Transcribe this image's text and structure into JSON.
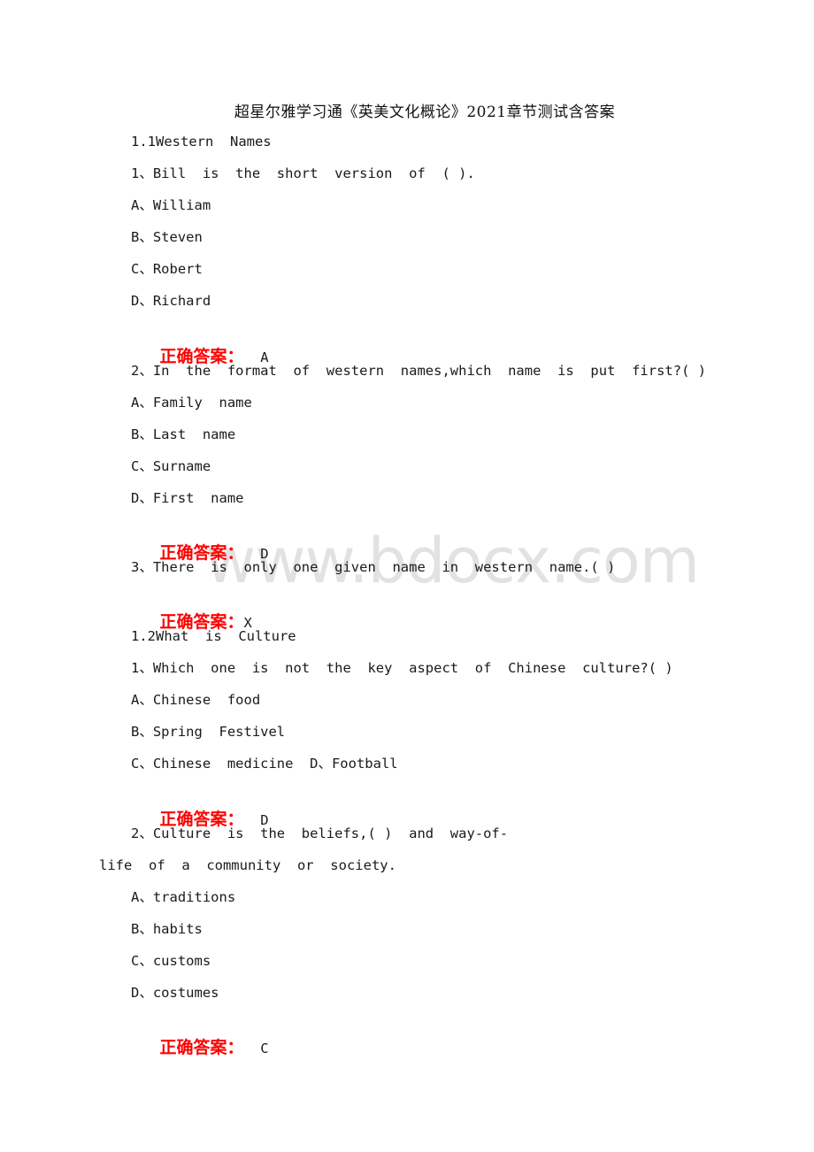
{
  "document": {
    "title": "超星尔雅学习通《英美文化概论》2021章节测试含答案",
    "watermark": "www.bdocx.com",
    "answer_label": "正确答案：",
    "colors": {
      "answer_label": "#ff0000",
      "text": "#1a1a1a"
    },
    "sections": [
      {
        "heading": "1.1Western  Names",
        "questions": [
          {
            "text": "1、Bill  is  the  short  version  of  ( ).",
            "options": [
              "A、William",
              "B、Steven",
              "C、Robert",
              "D、Richard"
            ],
            "answer": "  A"
          },
          {
            "text": "2、In  the  format  of  western  names,which  name  is  put  first?( )",
            "options": [
              "A、Family  name",
              "B、Last  name",
              "C、Surname",
              "D、First  name"
            ],
            "answer": "  D"
          },
          {
            "text": "3、There  is  only  one  given  name  in  western  name.( )",
            "options": [],
            "answer": "X"
          }
        ]
      },
      {
        "heading": "1.2What  is  Culture",
        "questions": [
          {
            "text": "1、Which  one  is  not  the  key  aspect  of  Chinese  culture?( )",
            "options": [
              "A、Chinese  food",
              "B、Spring  Festivel",
              "C、Chinese  medicine  D、Football"
            ],
            "answer": "  D"
          },
          {
            "text_line1": "2、Culture  is  the  beliefs,( )  and  way-of-",
            "text_line2": "life  of  a  community  or  society.",
            "options": [
              "A、traditions",
              "B、habits",
              "C、customs",
              "D、costumes"
            ],
            "answer": "  C"
          }
        ]
      }
    ]
  }
}
